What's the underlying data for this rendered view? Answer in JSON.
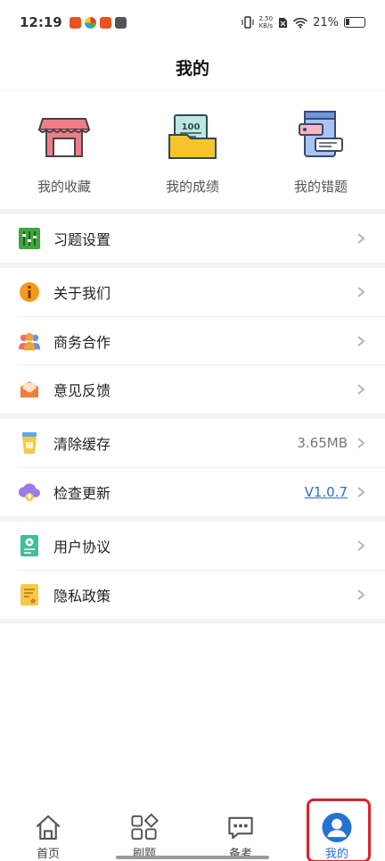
{
  "status_bar": {
    "time": "12:19",
    "speed_value": "2.50",
    "speed_unit": "KB/s",
    "battery": "21%"
  },
  "header": {
    "title": "我的"
  },
  "quick_actions": [
    {
      "label": "我的收藏",
      "icon": "shop-icon"
    },
    {
      "label": "我的成绩",
      "icon": "score-folder-icon"
    },
    {
      "label": "我的错题",
      "icon": "wrong-questions-icon"
    }
  ],
  "settings": {
    "practice": {
      "label": "习题设置",
      "icon": "sliders-icon"
    },
    "about": {
      "label": "关于我们",
      "icon": "info-icon"
    },
    "business": {
      "label": "商务合作",
      "icon": "people-icon"
    },
    "feedback": {
      "label": "意见反馈",
      "icon": "envelope-icon"
    },
    "cache": {
      "label": "清除缓存",
      "value": "3.65MB",
      "icon": "cup-icon"
    },
    "update": {
      "label": "检查更新",
      "value": "V1.0.7",
      "icon": "cloud-upload-icon"
    },
    "agreement": {
      "label": "用户协议",
      "icon": "agreement-doc-icon"
    },
    "privacy": {
      "label": "隐私政策",
      "icon": "privacy-doc-icon"
    }
  },
  "tabs": [
    {
      "label": "首页",
      "icon": "home-icon"
    },
    {
      "label": "刷题",
      "icon": "grid-icon"
    },
    {
      "label": "备考",
      "icon": "chat-dots-icon"
    },
    {
      "label": "我的",
      "icon": "user-avatar-icon",
      "active": true
    }
  ],
  "colors": {
    "accent": "#2672d4",
    "highlight_frame": "#d8262c",
    "section_gap": "#f2f3f5"
  }
}
